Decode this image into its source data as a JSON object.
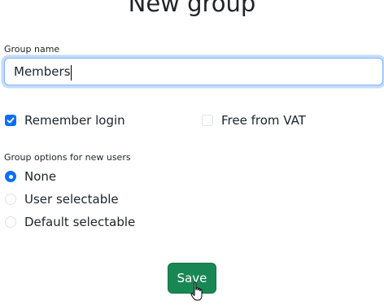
{
  "page": {
    "title": "New group"
  },
  "form": {
    "group_name_label": "Group name",
    "group_name_value": "Members",
    "remember_login_label": "Remember login",
    "remember_login_checked": true,
    "free_from_vat_label": "Free from VAT",
    "free_from_vat_checked": false,
    "options_label": "Group options for new users",
    "options": [
      {
        "label": "None",
        "selected": true
      },
      {
        "label": "User selectable",
        "selected": false
      },
      {
        "label": "Default selectable",
        "selected": false
      }
    ],
    "save_label": "Save"
  },
  "colors": {
    "accent": "#0d6efd",
    "save_button": "#198754"
  },
  "icons": {
    "checkmark": "check-icon",
    "cursor": "hand-pointer-icon"
  }
}
